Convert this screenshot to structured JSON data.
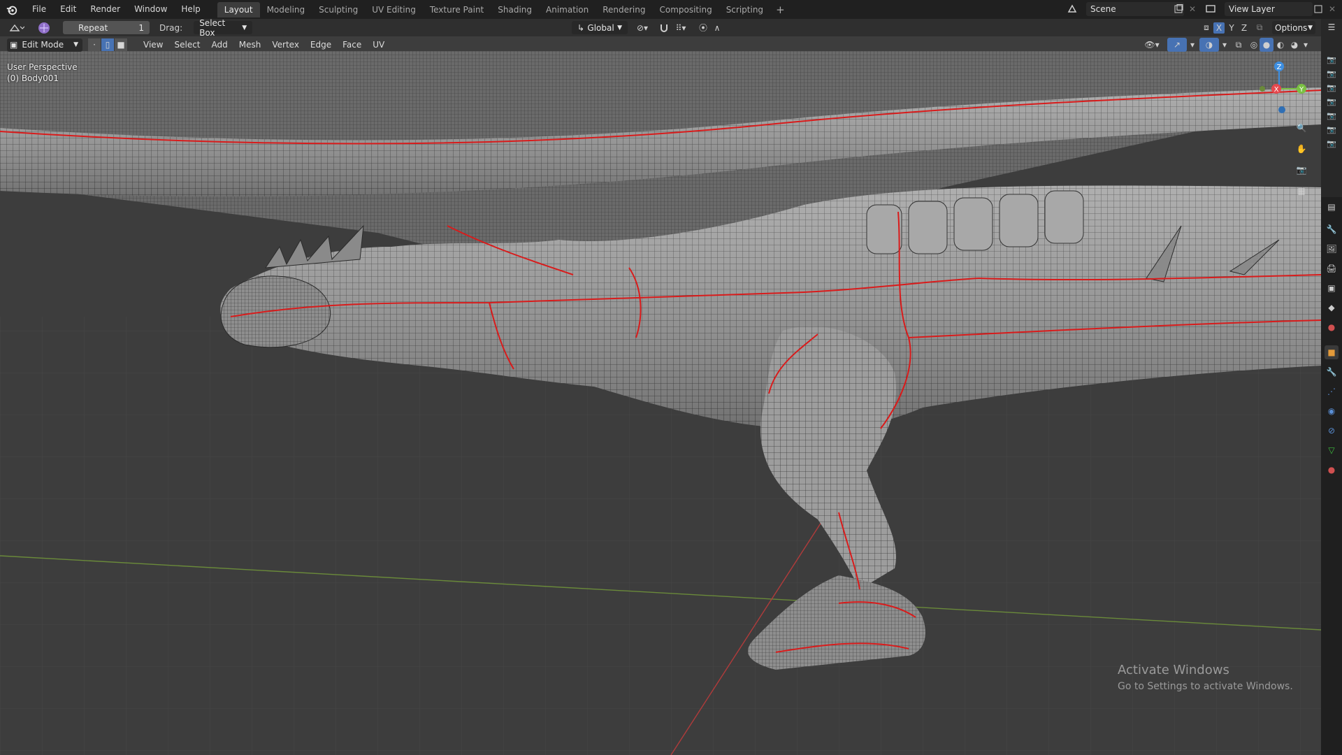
{
  "topbar": {
    "menus": [
      "File",
      "Edit",
      "Render",
      "Window",
      "Help"
    ],
    "workspaces": [
      "Layout",
      "Modeling",
      "Sculpting",
      "UV Editing",
      "Texture Paint",
      "Shading",
      "Animation",
      "Rendering",
      "Compositing",
      "Scripting"
    ],
    "active_workspace": "Layout",
    "add_workspace": "+",
    "scene": "Scene",
    "view_layer": "View Layer"
  },
  "toolheader": {
    "repeat_label": "Repeat",
    "repeat_count": "1",
    "drag_label": "Drag:",
    "drag_value": "Select Box",
    "orientation": "Global",
    "axis_x": "X",
    "axis_y": "Y",
    "axis_z": "Z",
    "options": "Options"
  },
  "editor": {
    "mode": "Edit Mode",
    "menus": [
      "View",
      "Select",
      "Add",
      "Mesh",
      "Vertex",
      "Edge",
      "Face",
      "UV"
    ]
  },
  "viewport": {
    "view_name": "User Perspective",
    "object_name": "(0) Body001",
    "gizmo_x": "X",
    "gizmo_y": "Y",
    "gizmo_z": "Z"
  },
  "watermark": {
    "title": "Activate Windows",
    "subtitle": "Go to Settings to activate Windows."
  },
  "colors": {
    "topbar": "#202020",
    "viewport_bg": "#3d3d3d",
    "seam": "#d91b1b",
    "axis_x": "#e5484d",
    "axis_y": "#7bc043",
    "axis_z": "#3d8ee0",
    "active_button": "#4772b3"
  },
  "icons": [
    "blender-logo-icon",
    "editor-type-icon",
    "snap-icon",
    "proportional-icon",
    "overlay-icon",
    "gizmo-icon",
    "zoom-icon",
    "hand-icon",
    "camera-icon",
    "grid-icon"
  ]
}
